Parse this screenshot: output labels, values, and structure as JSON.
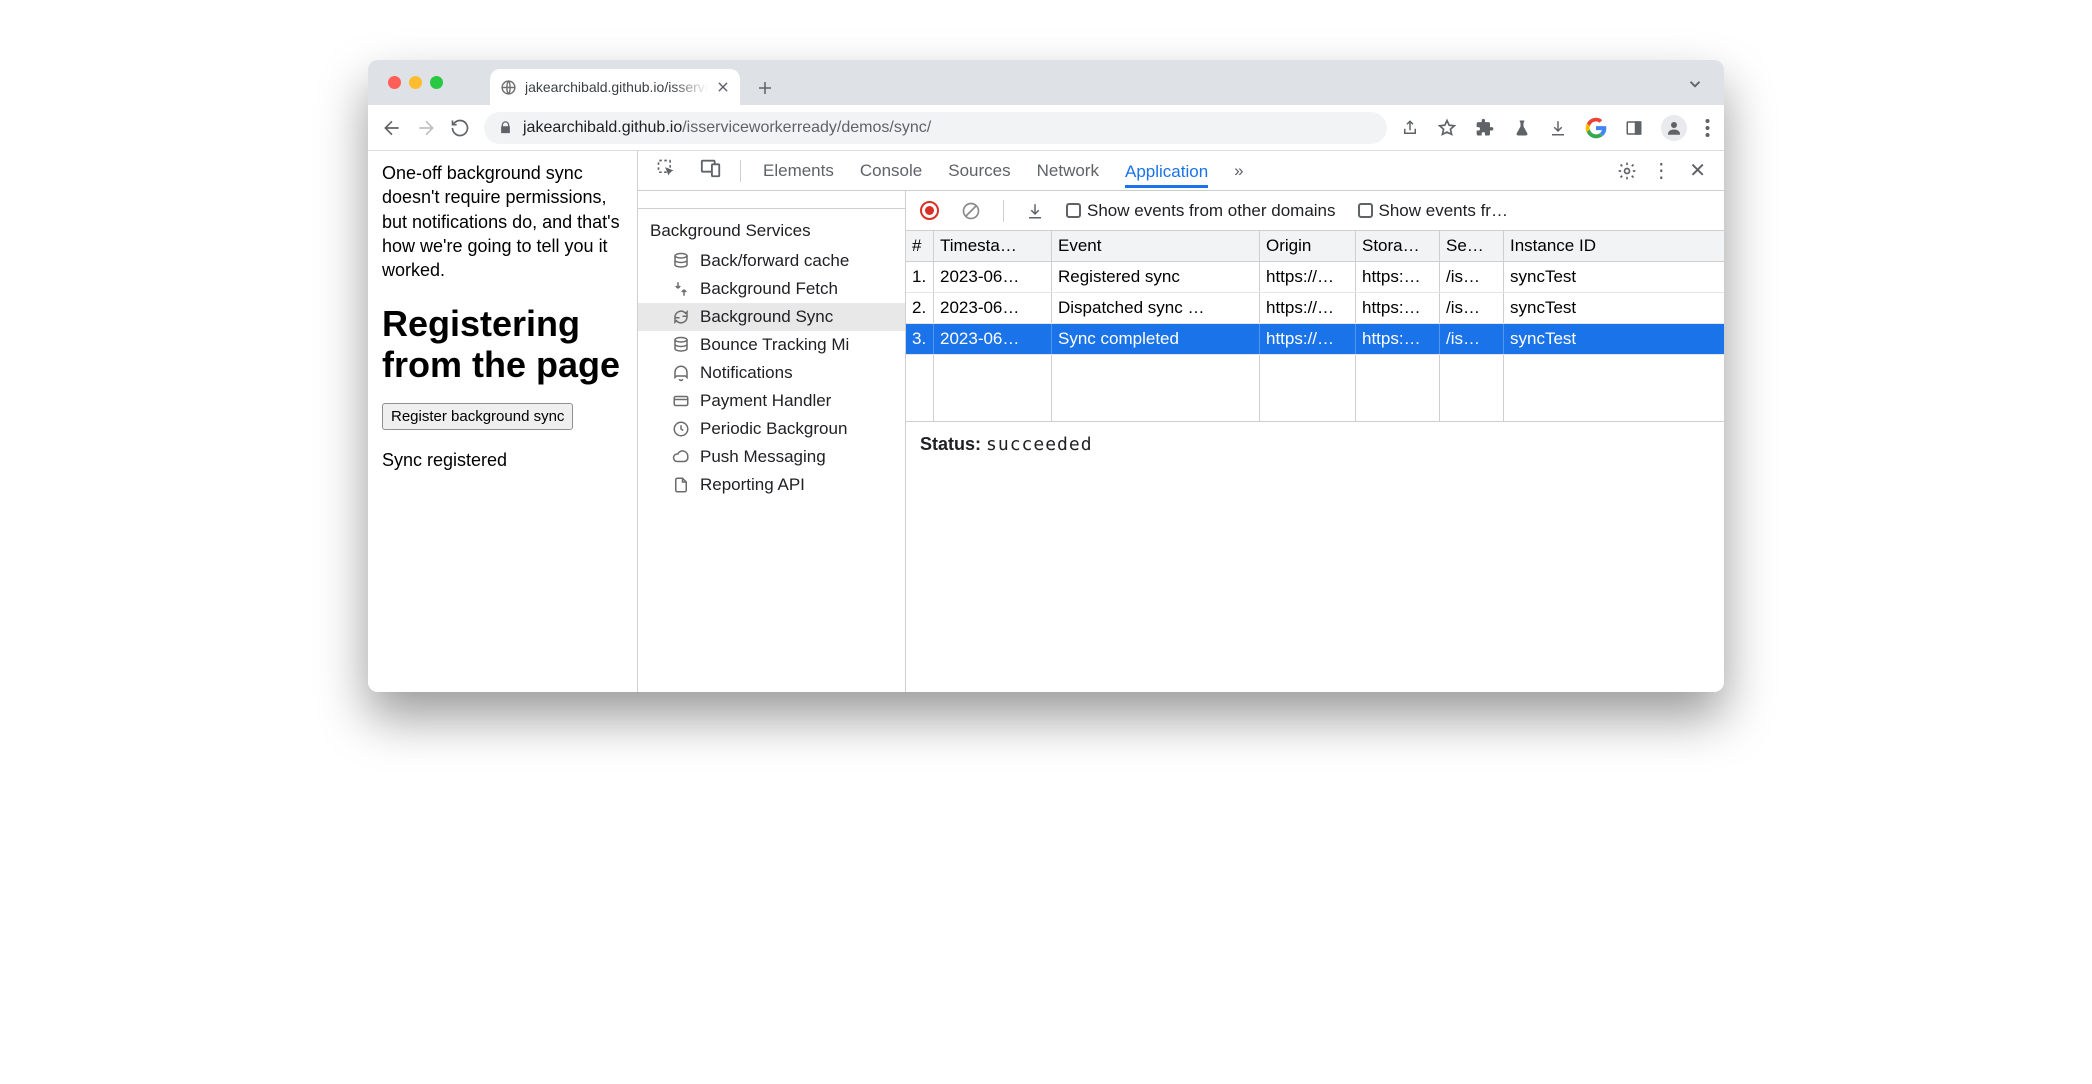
{
  "tab": {
    "title": "jakearchibald.github.io/isservic"
  },
  "url": {
    "host": "jakearchibald.github.io",
    "path": "/isserviceworkerready/demos/sync/"
  },
  "page": {
    "intro": "One-off background sync doesn't require permissions, but notifications do, and that's how we're going to tell you it worked.",
    "heading": "Registering from the page",
    "button": "Register background sync",
    "status": "Sync registered"
  },
  "devtools": {
    "tabs": [
      "Elements",
      "Console",
      "Sources",
      "Network",
      "Application"
    ],
    "active": "Application",
    "more": "»",
    "sidebar": {
      "section": "Background Services",
      "items": [
        {
          "label": "Back/forward cache"
        },
        {
          "label": "Background Fetch"
        },
        {
          "label": "Background Sync",
          "selected": true
        },
        {
          "label": "Bounce Tracking Mi"
        },
        {
          "label": "Notifications"
        },
        {
          "label": "Payment Handler"
        },
        {
          "label": "Periodic Backgroun"
        },
        {
          "label": "Push Messaging"
        },
        {
          "label": "Reporting API"
        }
      ]
    },
    "toolbar": {
      "cb1": "Show events from other domains",
      "cb2": "Show events fr…"
    },
    "columns": [
      "#",
      "Timesta…",
      "Event",
      "Origin",
      "Stora…",
      "Se…",
      "Instance ID"
    ],
    "rows": [
      {
        "n": "1.",
        "ts": "2023-06…",
        "event": "Registered sync",
        "origin": "https://…",
        "storage": "https:…",
        "scope": "/is…",
        "instance": "syncTest"
      },
      {
        "n": "2.",
        "ts": "2023-06…",
        "event": "Dispatched sync …",
        "origin": "https://…",
        "storage": "https:…",
        "scope": "/is…",
        "instance": "syncTest"
      },
      {
        "n": "3.",
        "ts": "2023-06…",
        "event": "Sync completed",
        "origin": "https://…",
        "storage": "https:…",
        "scope": "/is…",
        "instance": "syncTest",
        "selected": true
      }
    ],
    "detail": {
      "label": "Status:",
      "value": "succeeded"
    }
  }
}
